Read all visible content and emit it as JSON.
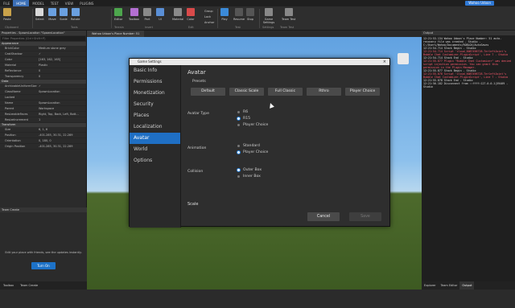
{
  "titlebar": {
    "tabs": [
      "FILE",
      "HOME",
      "MODEL",
      "TEST",
      "VIEW",
      "PLUGINS"
    ],
    "active_tab": "HOME",
    "user_button": "Wahoo Udoon"
  },
  "ribbon": {
    "buttons": [
      "Paste",
      "Select",
      "Move",
      "Scale",
      "Rotate",
      "Editor",
      "Toolbox",
      "Part",
      "UI",
      "Material",
      "Color",
      "Group",
      "Lock",
      "Anchor",
      "Play",
      "Resume",
      "Stop",
      "Game Settings",
      "Team Test"
    ],
    "groups": [
      "Clipboard",
      "Tools",
      "Terrain",
      "Insert",
      "Edit",
      "Test",
      "Settings",
      "Team Test"
    ]
  },
  "left_panel": {
    "header": "Properties - SpawnLocation \"SpawnLocation\"",
    "filter_placeholder": "Filter Properties (Ctrl+Shift+P)",
    "section_appearance": "Appearance",
    "rows_appearance": [
      {
        "k": "BrickColor",
        "v": "Medium stone grey"
      },
      {
        "k": "CastShadow",
        "v": "✓"
      },
      {
        "k": "Color",
        "v": "[163, 162, 165]"
      },
      {
        "k": "Material",
        "v": "Plastic"
      },
      {
        "k": "Reflectance",
        "v": "0"
      },
      {
        "k": "Transparency",
        "v": "0"
      }
    ],
    "section_data": "Data",
    "rows_data": [
      {
        "k": "ArchivableUniformSize",
        "v": "✓"
      },
      {
        "k": "ClassName",
        "v": "SpawnLocation"
      },
      {
        "k": "Locked",
        "v": ""
      },
      {
        "k": "Name",
        "v": "SpawnLocation"
      },
      {
        "k": "Parent",
        "v": "Workspace"
      },
      {
        "k": "ResizeableFaces",
        "v": "Right, Top, Back, Left, Bott..."
      },
      {
        "k": "ResizeIncrement",
        "v": "1"
      }
    ],
    "section_transform": "Transform",
    "rows_transform": [
      {
        "k": "Size",
        "v": "6, 1, 6"
      },
      {
        "k": "Position",
        "v": "-401.285, 30.31, 22.289"
      },
      {
        "k": "Orientation",
        "v": "0, 180, 0"
      },
      {
        "k": "Origin Position",
        "v": "-401.285, 30.31, 22.289"
      }
    ],
    "team_create_header": "Team Create",
    "team_create_text": "Edit your place with friends, see the updates instantly.",
    "team_create_button": "Turn On",
    "bottom_tabs": [
      "Toolbox",
      "Team Create"
    ]
  },
  "viewport": {
    "tab_label": "Wahoo Udoon's Place Number: 51"
  },
  "output": {
    "header": "Output",
    "lines": [
      {
        "t": "12:21:53.134  Wahoo Udoon's Place Number: 51 auto-recovery file was created  -  Studio - C:/Users/Wahoo/Documents/ROBLOX/AutoSaves",
        "c": "w"
      },
      {
        "t": "12:21:54.714  Stack Begin  -  Studio",
        "c": "w"
      },
      {
        "t": "12:21:54.714  Script 'cloud_6087496728.TerleftJoint's Bubble Chat Customizer.PluginScript', Line 7  -  Studio",
        "c": "r"
      },
      {
        "t": "12:21:54.714  Stack End  -  Studio",
        "c": "w"
      },
      {
        "t": "12:21:55.877  Plugin \"Bubble Chat Customizer\" was denied script injection permission. You can grant this permission in the Plugin Manager.",
        "c": "r"
      },
      {
        "t": "12:21:55.877  Stack Begin  -  Studio",
        "c": "w"
      },
      {
        "t": "12:21:55.878  Script 'cloud_6087496728.TerleftJoint's Bubble Chat Customizer.PluginScript', Line 7  -  Studio",
        "c": "r"
      },
      {
        "t": "12:21:55.878  Stack End  -  Studio",
        "c": "w"
      },
      {
        "t": "12:21:56.182  Disconnect from ::ffff:127.0.0.1|59409  -  Studio",
        "c": "w"
      }
    ],
    "bottom_tabs": [
      "Explorer",
      "Team Editor",
      "Output"
    ],
    "active_tab": "Output"
  },
  "dialog": {
    "title": "Game Settings",
    "sidebar": [
      "Basic Info",
      "Permissions",
      "Monetization",
      "Security",
      "Places",
      "Localization",
      "Avatar",
      "World",
      "Options"
    ],
    "selected": "Avatar",
    "heading": "Avatar",
    "presets_label": "Presets",
    "presets": [
      "Default",
      "Classic Scale",
      "Full Classic",
      "Rthro",
      "Player Choice"
    ],
    "avatar_type_label": "Avatar Type",
    "avatar_type_options": [
      "R6",
      "R15",
      "Player Choice"
    ],
    "avatar_type_selected": "R15",
    "animation_label": "Animation",
    "animation_options": [
      "Standard",
      "Player Choice"
    ],
    "animation_selected": "Player Choice",
    "collision_label": "Collision",
    "collision_options": [
      "Outer Box",
      "Inner Box"
    ],
    "collision_selected": "Outer Box",
    "scale_label": "Scale",
    "cancel": "Cancel",
    "save": "Save"
  },
  "colors": {
    "accent": "#1f6fc4",
    "output_error": "#ff5a6e"
  }
}
